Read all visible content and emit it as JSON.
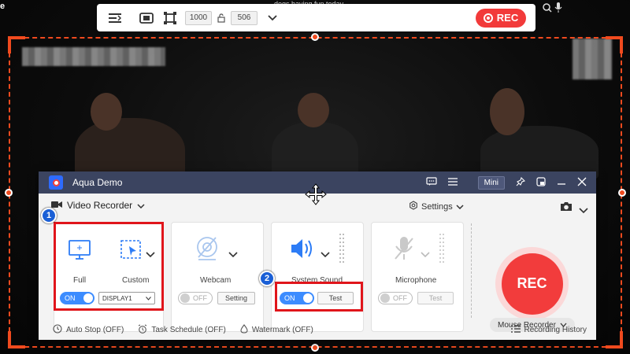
{
  "background": {
    "top_video_text": "dogs having fun today",
    "top_left_letter": "e"
  },
  "toolbar": {
    "width_value": "1000",
    "height_value": "506",
    "rec_label": "REC"
  },
  "panel": {
    "app_title": "Aqua Demo",
    "mini_label": "Mini",
    "mode_label": "Video Recorder",
    "settings_label": "Settings",
    "display": {
      "full_label": "Full",
      "custom_label": "Custom",
      "toggle_state": "ON",
      "display_select": "DISPLAY1"
    },
    "webcam": {
      "label": "Webcam",
      "toggle_state": "OFF",
      "button": "Setting"
    },
    "system_sound": {
      "label": "System Sound",
      "toggle_state": "ON",
      "button": "Test"
    },
    "microphone": {
      "label": "Microphone",
      "toggle_state": "OFF",
      "button": "Test"
    },
    "rec_button": "REC",
    "mouse_recorder": "Mouse Recorder",
    "footer": {
      "auto_stop": "Auto Stop (OFF)",
      "task_schedule": "Task Schedule (OFF)",
      "watermark": "Watermark (OFF)",
      "recording_history": "Recording History"
    },
    "badges": [
      "1",
      "2"
    ]
  },
  "colors": {
    "accent_red": "#f23a3a",
    "frame_orange": "#f04a1e",
    "toggle_blue": "#3c8cff",
    "titlebar": "#3b4460"
  }
}
